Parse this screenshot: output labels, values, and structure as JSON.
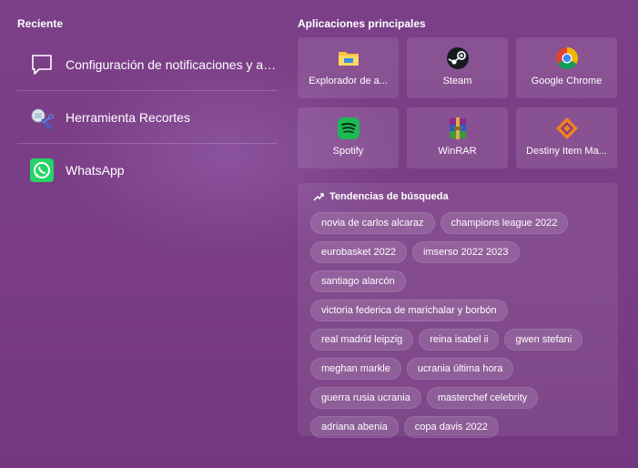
{
  "recent": {
    "title": "Reciente",
    "items": [
      {
        "label": "Configuración de notificaciones y acc...",
        "icon": "notification-settings-icon"
      },
      {
        "label": "Herramienta Recortes",
        "icon": "snipping-tool-icon"
      },
      {
        "label": "WhatsApp",
        "icon": "whatsapp-icon"
      }
    ]
  },
  "top_apps": {
    "title": "Aplicaciones principales",
    "items": [
      {
        "label": "Explorador de a...",
        "icon": "file-explorer-icon"
      },
      {
        "label": "Steam",
        "icon": "steam-icon"
      },
      {
        "label": "Google Chrome",
        "icon": "chrome-icon"
      },
      {
        "label": "Spotify",
        "icon": "spotify-icon"
      },
      {
        "label": "WinRAR",
        "icon": "winrar-icon"
      },
      {
        "label": "Destiny Item Ma...",
        "icon": "destiny-item-manager-icon"
      }
    ]
  },
  "trends": {
    "title": "Tendencias de búsqueda",
    "rows": [
      [
        "novia de carlos alcaraz",
        "champions league 2022"
      ],
      [
        "eurobasket 2022",
        "imserso 2022 2023"
      ],
      [
        "santiago alarcón"
      ],
      [
        "victoria federica de marichalar y borbón"
      ],
      [
        "real madrid leipzig",
        "reina isabel ii",
        "gwen stefani"
      ],
      [
        "meghan markle",
        "ucrania última hora"
      ],
      [
        "guerra rusia ucrania",
        "masterchef celebrity"
      ],
      [
        "adriana abenia",
        "copa davis 2022"
      ]
    ]
  },
  "colors": {
    "background": "#7a3d86",
    "whatsapp": "#25d366",
    "spotify": "#1db954",
    "steam": "#171a21",
    "dim_orange": "#f37f20"
  }
}
